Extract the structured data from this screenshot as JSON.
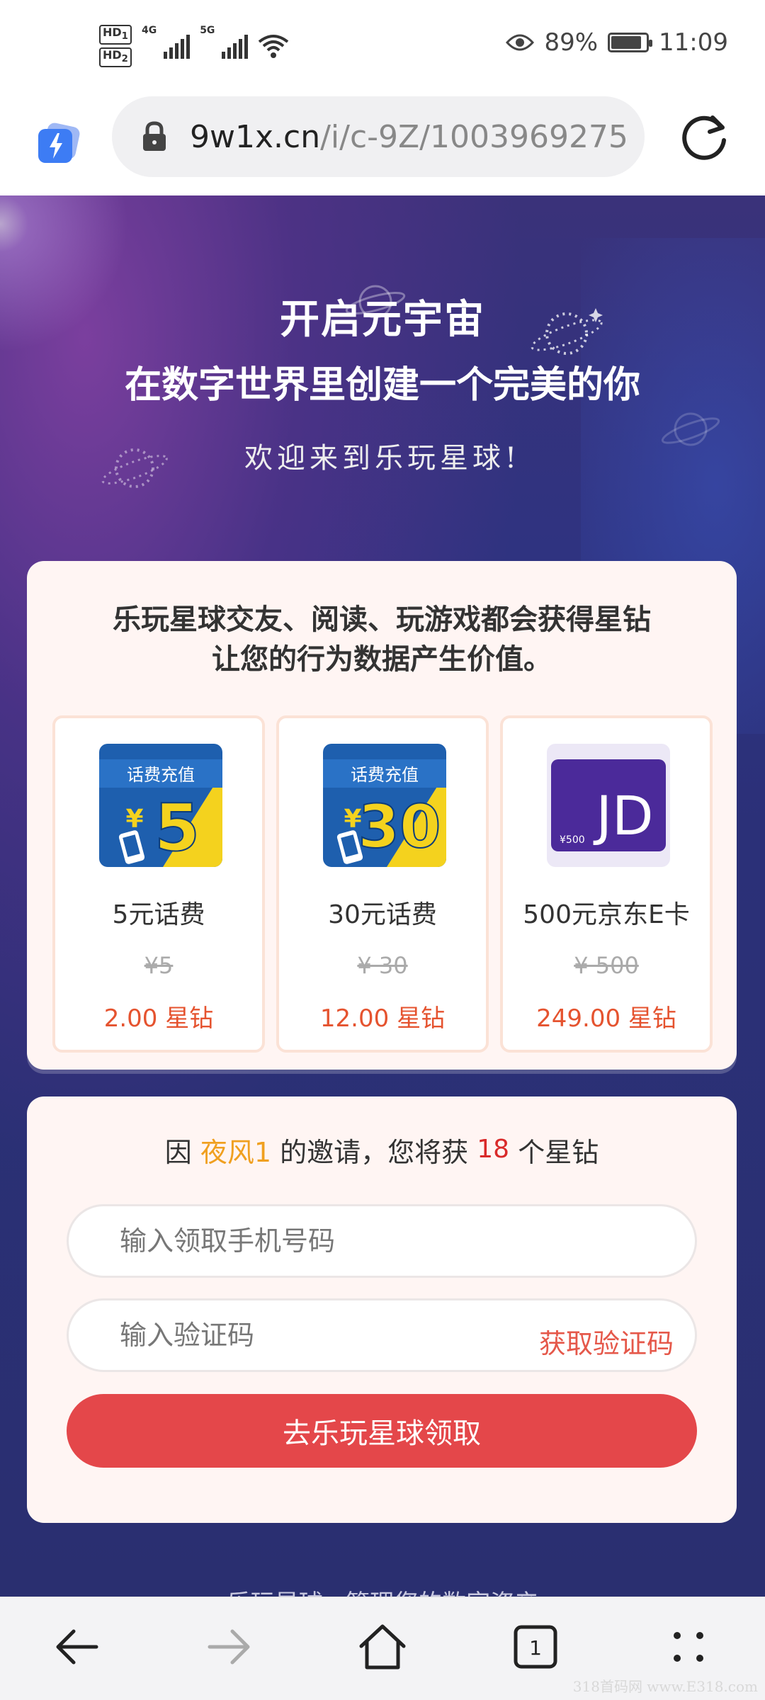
{
  "status_bar": {
    "hd1": "HD",
    "hd1_sub": "1",
    "hd2": "HD",
    "hd2_sub": "2",
    "net1": "4G",
    "net2": "5G",
    "battery_percent": "89%",
    "battery_level": 0.89,
    "time": "11:09"
  },
  "browser": {
    "url_host": "9w1x.cn",
    "url_path": "/i/c-9Z/1003969275",
    "icons": [
      "bolt-icon",
      "lock-icon",
      "reload-icon"
    ]
  },
  "hero": {
    "title1": "开启元宇宙",
    "title2": "在数字世界里创建一个完美的你",
    "subtitle": "欢迎来到乐玩星球!"
  },
  "rewards_card": {
    "heading_line1": "乐玩星球交友、阅读、玩游戏都会获得星钻",
    "heading_line2": "让您的行为数据产生价值。",
    "prizes": [
      {
        "badge_text": "话费充值",
        "amount_big": "5",
        "name": "5元话费",
        "orig": "¥5",
        "price": "2.00 星钻"
      },
      {
        "badge_text": "话费充值",
        "amount_big": "30",
        "name": "30元话费",
        "orig": "¥ 30",
        "price": "12.00 星钻"
      },
      {
        "card_label": "JD",
        "card_value": "¥500",
        "name": "500元京东E卡",
        "orig": "¥ 500",
        "price": "249.00 星钻"
      }
    ]
  },
  "invite_card": {
    "prefix": "因",
    "inviter": "夜风1",
    "middle": "的邀请，您将获",
    "amount": "18",
    "suffix": "个星钻",
    "phone_placeholder": "输入领取手机号码",
    "code_placeholder": "输入验证码",
    "get_code": "获取验证码",
    "submit": "去乐玩星球领取"
  },
  "footer": {
    "text": "乐玩星球 · 管理您的数字资产"
  },
  "nav": {
    "tab_count": "1",
    "icons": [
      "back-arrow-icon",
      "forward-arrow-icon",
      "home-icon",
      "tabs-icon",
      "menu-dots-icon"
    ]
  },
  "watermark": "318首码网 www.E318.com",
  "colors": {
    "accent_red": "#e4474a",
    "price_orange": "#e5532f",
    "inviter_gold": "#f0a020"
  }
}
